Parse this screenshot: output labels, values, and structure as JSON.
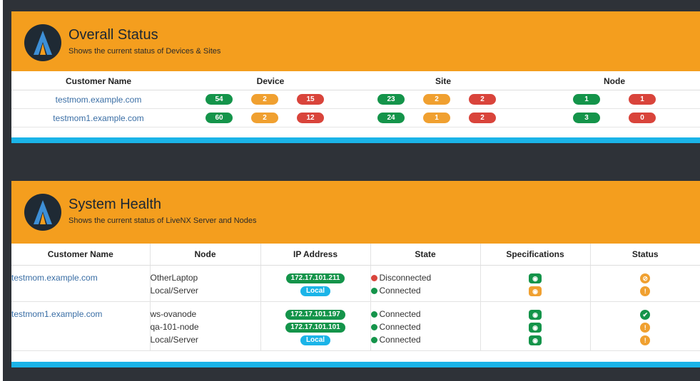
{
  "colors": {
    "header_orange": "#f49e1e",
    "ok_green": "#14944a",
    "warn_orange": "#f0a030",
    "error_red": "#d9443b",
    "info_blue": "#1bb4e8",
    "link_blue": "#3a6ea5",
    "background_dark": "#2e3238"
  },
  "overall": {
    "title": "Overall Status",
    "subtitle": "Shows the current status of Devices & Sites",
    "columns": [
      "Customer Name",
      "Device",
      "Site",
      "Node"
    ],
    "rows": [
      {
        "customer": "testmom.example.com",
        "device": [
          "54",
          "2",
          "15"
        ],
        "site": [
          "23",
          "2",
          "2"
        ],
        "node": [
          "1",
          "1"
        ]
      },
      {
        "customer": "testmom1.example.com",
        "device": [
          "60",
          "2",
          "12"
        ],
        "site": [
          "24",
          "1",
          "2"
        ],
        "node": [
          "3",
          "0"
        ]
      }
    ]
  },
  "health": {
    "title": "System Health",
    "subtitle": "Shows the current status of LiveNX Server and Nodes",
    "columns": [
      "Customer Name",
      "Node",
      "IP Address",
      "State",
      "Specifications",
      "Status"
    ],
    "groups": [
      {
        "customer": "testmom.example.com",
        "nodes": [
          {
            "name": "OtherLaptop",
            "ip": "172.17.101.211",
            "state": "Disconnected",
            "state_color": "red",
            "spec_icon": "circle-dot-icon",
            "spec_color": "green",
            "status_icon": "ban-icon",
            "status_color": "orange"
          },
          {
            "name": "Local/Server",
            "ip": "Local",
            "state": "Connected",
            "state_color": "green",
            "spec_icon": "circle-dot-icon",
            "spec_color": "orange",
            "status_icon": "warning-icon",
            "status_color": "orange"
          }
        ]
      },
      {
        "customer": "testmom1.example.com",
        "nodes": [
          {
            "name": "ws-ovanode",
            "ip": "172.17.101.197",
            "state": "Connected",
            "state_color": "green",
            "spec_icon": "circle-dot-icon",
            "spec_color": "green",
            "status_icon": "check-icon",
            "status_color": "green"
          },
          {
            "name": "qa-101-node",
            "ip": "172.17.101.101",
            "state": "Connected",
            "state_color": "green",
            "spec_icon": "circle-dot-icon",
            "spec_color": "green",
            "status_icon": "warning-icon",
            "status_color": "orange"
          },
          {
            "name": "Local/Server",
            "ip": "Local",
            "state": "Connected",
            "state_color": "green",
            "spec_icon": "circle-dot-icon",
            "spec_color": "green",
            "status_icon": "warning-icon",
            "status_color": "orange"
          }
        ]
      }
    ]
  }
}
